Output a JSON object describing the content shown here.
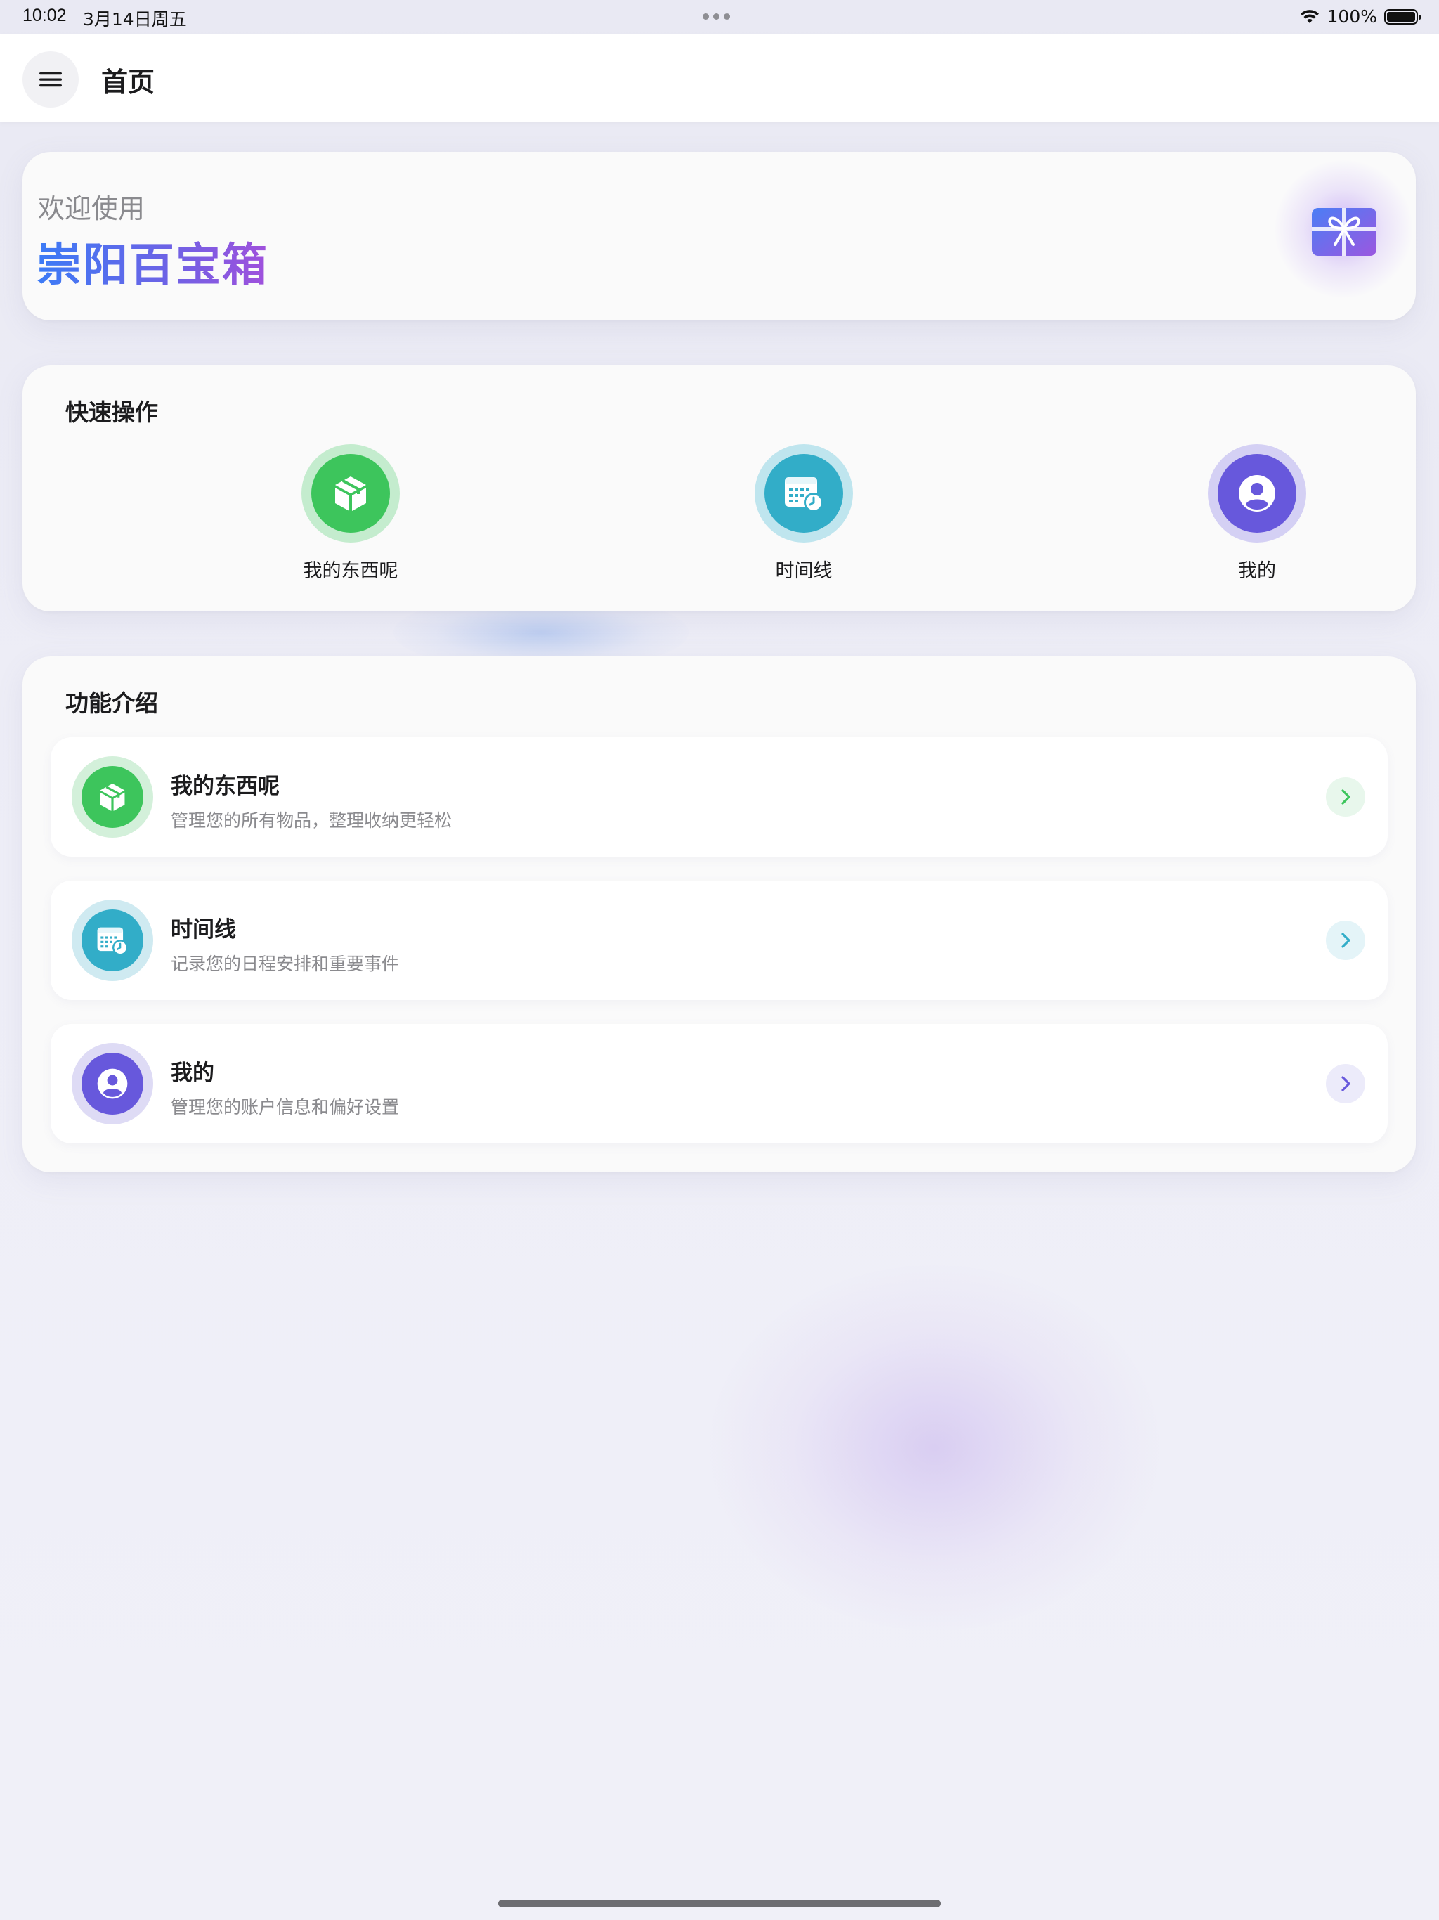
{
  "status_bar": {
    "time": "10:02",
    "date": "3月14日周五",
    "battery": "100%",
    "battery_level": 1.0
  },
  "nav": {
    "title": "首页",
    "menu_icon": "hamburger-menu-icon"
  },
  "welcome": {
    "subtitle": "欢迎使用",
    "title": "崇阳百宝箱",
    "gradient": [
      "#3b7bf6",
      "#a050dc"
    ],
    "icon": "gift-icon"
  },
  "quick_actions": {
    "title": "快速操作",
    "items": [
      {
        "label": "我的东西呢",
        "icon": "box-icon",
        "color": "#3dc55c",
        "ring": "#c4ecce"
      },
      {
        "label": "时间线",
        "icon": "calendar-clock-icon",
        "color": "#32adc8",
        "ring": "#bfe5ee"
      },
      {
        "label": "我的",
        "icon": "user-icon",
        "color": "#6758dc",
        "ring": "#d4d0f4"
      }
    ]
  },
  "features": {
    "title": "功能介绍",
    "items": [
      {
        "title": "我的东西呢",
        "desc": "管理您的所有物品，整理收纳更轻松",
        "icon": "box-icon",
        "color": "#3dc55c",
        "ring": "#d3f0da",
        "chevron_bg": "#e8f7ec",
        "chevron_color": "#3dc55c"
      },
      {
        "title": "时间线",
        "desc": "记录您的日程安排和重要事件",
        "icon": "calendar-clock-icon",
        "color": "#32adc8",
        "ring": "#cfeaf1",
        "chevron_bg": "#e4f4f8",
        "chevron_color": "#32adc8"
      },
      {
        "title": "我的",
        "desc": "管理您的账户信息和偏好设置",
        "icon": "user-icon",
        "color": "#6758dc",
        "ring": "#dedbf5",
        "chevron_bg": "#ecebfa",
        "chevron_color": "#6758dc"
      }
    ]
  }
}
